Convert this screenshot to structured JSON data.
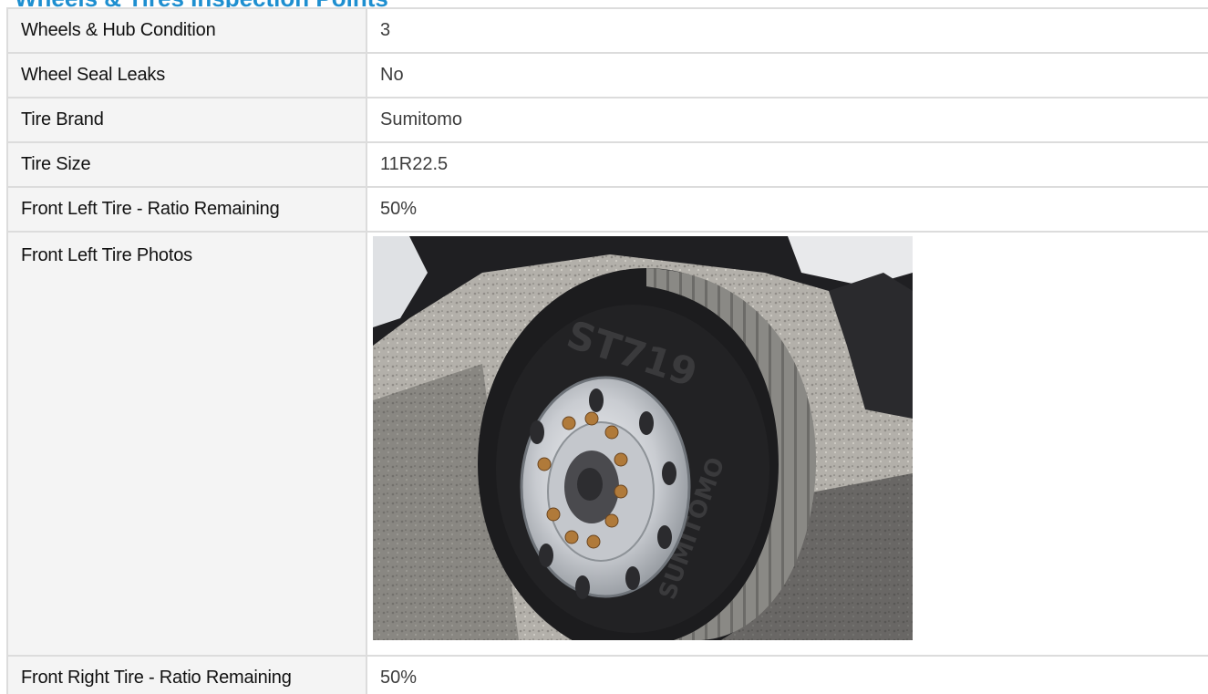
{
  "section": {
    "title": "Wheels & Tires Inspection Points"
  },
  "rows": [
    {
      "label": "Wheels & Hub Condition",
      "value": "3"
    },
    {
      "label": "Wheel Seal Leaks",
      "value": "No"
    },
    {
      "label": "Tire Brand",
      "value": "Sumitomo"
    },
    {
      "label": "Tire Size",
      "value": "11R22.5"
    },
    {
      "label": "Front Left Tire - Ratio Remaining",
      "value": "50%"
    },
    {
      "label": "Front Left Tire Photos",
      "value": ""
    },
    {
      "label": "Front Right Tire - Ratio Remaining",
      "value": "50%"
    }
  ],
  "photo": {
    "icon": "tire-photo",
    "tread_text": "ST719",
    "brand_text": "SUMITOMO"
  }
}
